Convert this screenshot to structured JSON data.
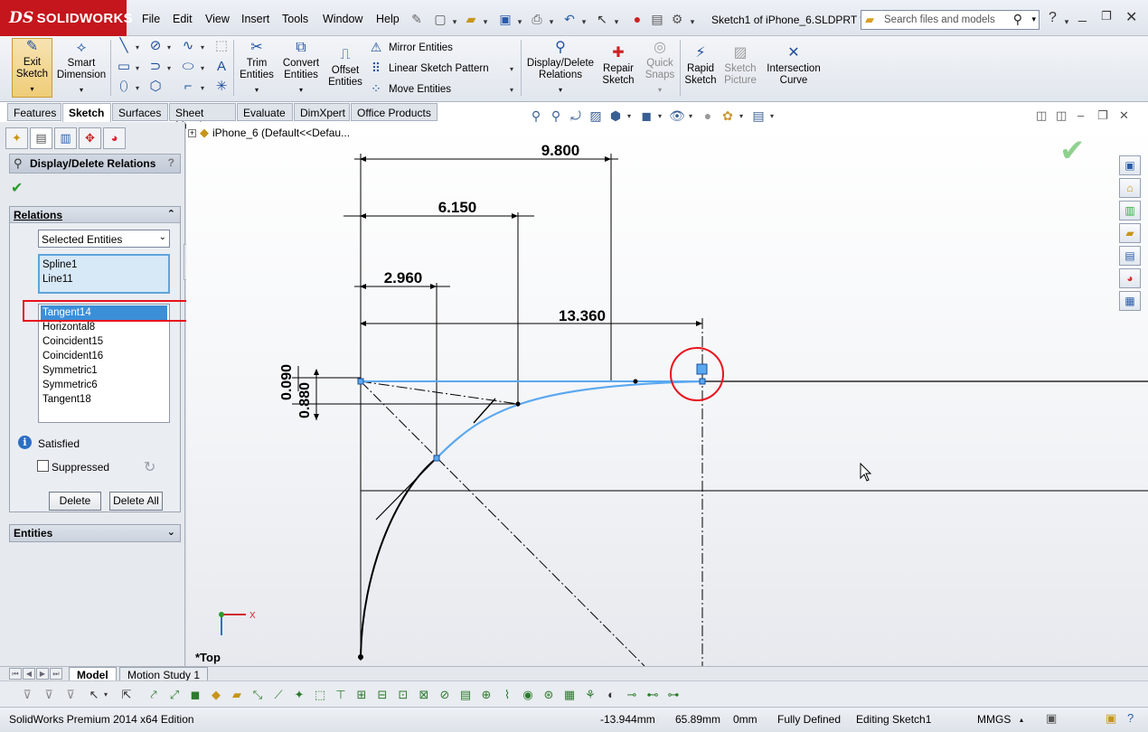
{
  "app": {
    "logo": "SOLIDWORKS",
    "doc_title": "Sketch1 of iPhone_6.SLDPRT *",
    "search_placeholder": "Search files and models"
  },
  "menu": [
    "File",
    "Edit",
    "View",
    "Insert",
    "Tools",
    "Window",
    "Help"
  ],
  "toolbar": {
    "exit_sketch": "Exit\nSketch",
    "smart_dimension": "Smart\nDimension",
    "trim_entities": "Trim\nEntities",
    "convert_entities": "Convert\nEntities",
    "offset_entities": "Offset\nEntities",
    "mirror_entities": "Mirror Entities",
    "linear_sketch_pattern": "Linear Sketch Pattern",
    "move_entities": "Move Entities",
    "display_delete_relations": "Display/Delete\nRelations",
    "repair_sketch": "Repair\nSketch",
    "quick_snaps": "Quick\nSnaps",
    "rapid_sketch": "Rapid\nSketch",
    "sketch_picture": "Sketch\nPicture",
    "intersection_curve": "Intersection\nCurve"
  },
  "tabs": [
    "Features",
    "Sketch",
    "Surfaces",
    "Sheet Metal",
    "Evaluate",
    "DimXpert",
    "Office Products"
  ],
  "active_tab": "Sketch",
  "property_manager": {
    "title": "Display/Delete Relations",
    "help": "?",
    "relations_group": "Relations",
    "filter_value": "Selected Entities",
    "entities_selected": [
      "Spline1",
      "Line11"
    ],
    "relations": [
      "Tangent14",
      "Horizontal8",
      "Coincident15",
      "Coincident16",
      "Symmetric1",
      "Symmetric6",
      "Tangent18"
    ],
    "selected_relation": "Tangent14",
    "status": "Satisfied",
    "suppressed_label": "Suppressed",
    "suppressed_checked": false,
    "delete_label": "Delete",
    "delete_all_label": "Delete All",
    "entities_group": "Entities"
  },
  "graphics": {
    "tree_node": "iPhone_6  (Default<<Defau...",
    "view_name": "*Top",
    "dimensions": {
      "d1": "9.800",
      "d2": "6.150",
      "d3": "2.960",
      "d4": "13.360",
      "d5": "0.090",
      "d6": "0.880"
    },
    "triad_x": "X",
    "colors": {
      "sketch_selected": "#5aa8f0",
      "highlight_red": "#e8131d"
    }
  },
  "model_tabs": [
    "Model",
    "Motion Study 1"
  ],
  "active_model_tab": "Model",
  "statusbar": {
    "edition": "SolidWorks Premium 2014 x64 Edition",
    "x": "-13.944mm",
    "y": "65.89mm",
    "z": "0mm",
    "state": "Fully Defined",
    "editing": "Editing Sketch1",
    "units": "MMGS"
  }
}
